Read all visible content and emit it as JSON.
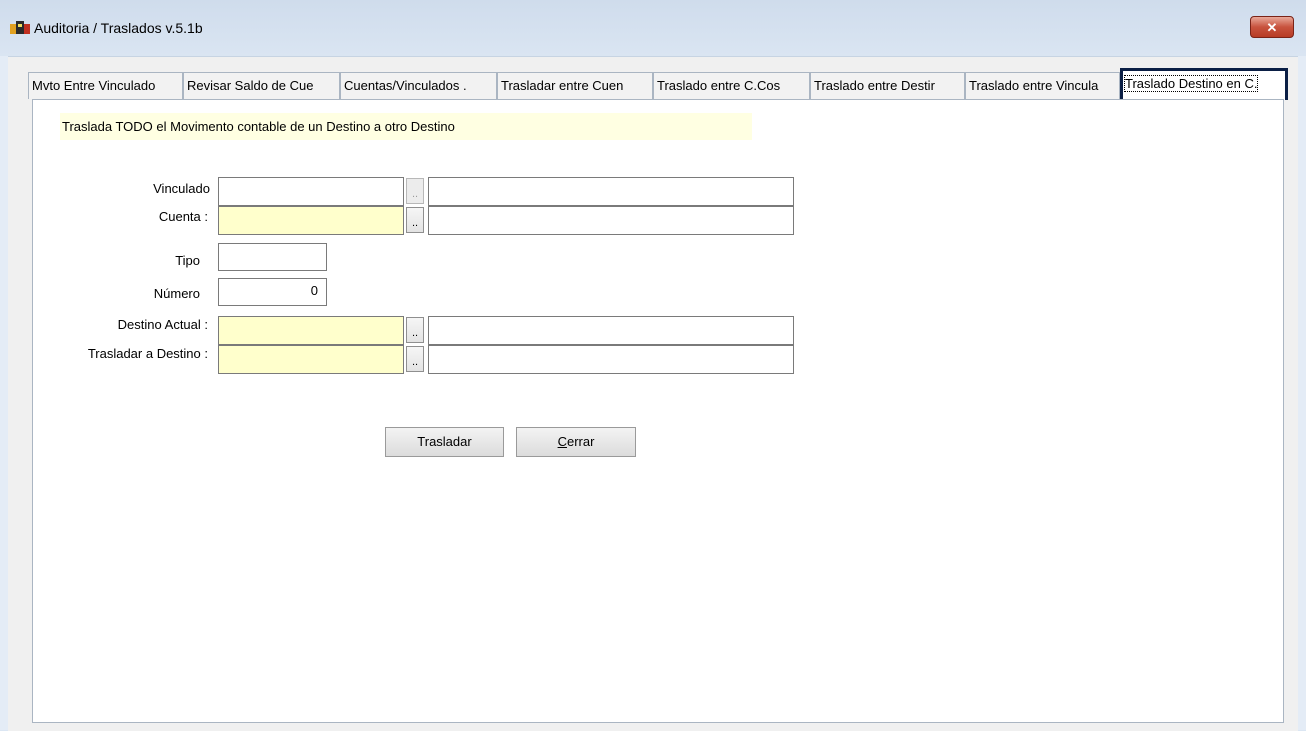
{
  "window": {
    "title": "Auditoria / Traslados  v.5.1b",
    "close_glyph": "✕",
    "icon": "app-icon"
  },
  "tabs": [
    {
      "label": "Mvto Entre Vinculado"
    },
    {
      "label": "Revisar Saldo de Cue"
    },
    {
      "label": "Cuentas/Vinculados ."
    },
    {
      "label": "Trasladar entre Cuen"
    },
    {
      "label": "Traslado entre C.Cos"
    },
    {
      "label": "Traslado entre Destir"
    },
    {
      "label": "Traslado entre Vincula"
    },
    {
      "label": "Traslado Destino en C.",
      "active": true
    }
  ],
  "info_text": "Traslada TODO el Movimento contable de un Destino a otro Destino",
  "form": {
    "vinculado": {
      "label": "Vinculado",
      "code": "",
      "desc": ""
    },
    "cuenta": {
      "label": "Cuenta :",
      "code": "",
      "desc": ""
    },
    "tipo": {
      "label": "Tipo",
      "value": ""
    },
    "numero": {
      "label": "Número",
      "value": "0"
    },
    "destino_actual": {
      "label": "Destino Actual :",
      "code": "",
      "desc": ""
    },
    "trasladar_destino": {
      "label": "Trasladar a Destino :",
      "code": "",
      "desc": ""
    },
    "browse_label": ".."
  },
  "buttons": {
    "trasladar": "Trasladar",
    "cerrar_mnemonic": "C",
    "cerrar_rest": "errar"
  },
  "colors": {
    "required_field": "#ffffcc",
    "info_bg": "#ffffe2",
    "active_tab_border": "#0b1f45",
    "close_button": "#c8533e"
  }
}
